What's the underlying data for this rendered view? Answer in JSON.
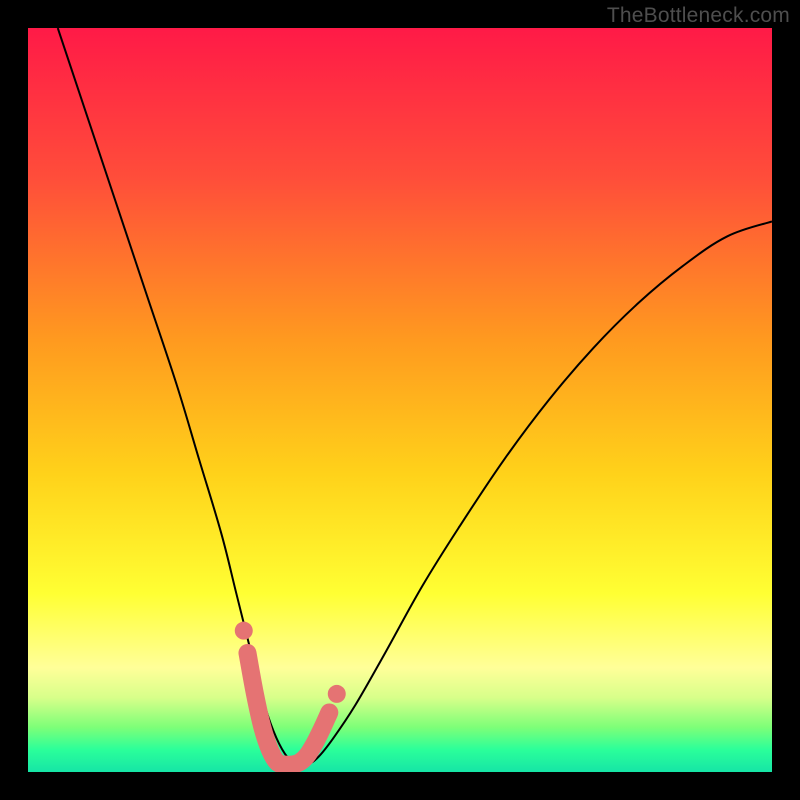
{
  "watermark": "TheBottleneck.com",
  "chart_data": {
    "type": "line",
    "title": "",
    "xlabel": "",
    "ylabel": "",
    "xlim": [
      0,
      100
    ],
    "ylim": [
      0,
      100
    ],
    "grid": false,
    "legend": false,
    "gradient_stops": [
      {
        "offset": 0.0,
        "color": "#ff1a47"
      },
      {
        "offset": 0.2,
        "color": "#ff4d3a"
      },
      {
        "offset": 0.42,
        "color": "#ff9a1f"
      },
      {
        "offset": 0.6,
        "color": "#ffd21a"
      },
      {
        "offset": 0.76,
        "color": "#ffff33"
      },
      {
        "offset": 0.86,
        "color": "#ffff99"
      },
      {
        "offset": 0.9,
        "color": "#d8ff8a"
      },
      {
        "offset": 0.94,
        "color": "#7dff78"
      },
      {
        "offset": 0.97,
        "color": "#2bff9a"
      },
      {
        "offset": 1.0,
        "color": "#16e5a6"
      }
    ],
    "series": [
      {
        "name": "bottleneck-curve",
        "style": "thin-black",
        "x": [
          4,
          8,
          12,
          16,
          20,
          23,
          26,
          28,
          30,
          31.5,
          33,
          34.5,
          36,
          37.5,
          39,
          41,
          44,
          48,
          53,
          58,
          64,
          70,
          76,
          82,
          88,
          94,
          100
        ],
        "y": [
          100,
          88,
          76,
          64,
          52,
          42,
          32,
          24,
          16,
          10,
          5.5,
          2.5,
          1,
          1,
          2,
          4.5,
          9,
          16,
          25,
          33,
          42,
          50,
          57,
          63,
          68,
          72,
          74
        ]
      },
      {
        "name": "valley-highlight",
        "style": "thick-pink",
        "x": [
          29.5,
          30.5,
          31.5,
          32.5,
          33.5,
          34.5,
          35.5,
          36.5,
          37.5,
          38.5,
          39.5,
          40.5
        ],
        "y": [
          16,
          10.5,
          6,
          3,
          1.3,
          1,
          1,
          1.3,
          2.2,
          3.8,
          5.8,
          8
        ]
      }
    ],
    "dots": [
      {
        "x": 29.0,
        "y": 19.0
      },
      {
        "x": 41.5,
        "y": 10.5
      }
    ],
    "dot_color": "#e57373"
  }
}
